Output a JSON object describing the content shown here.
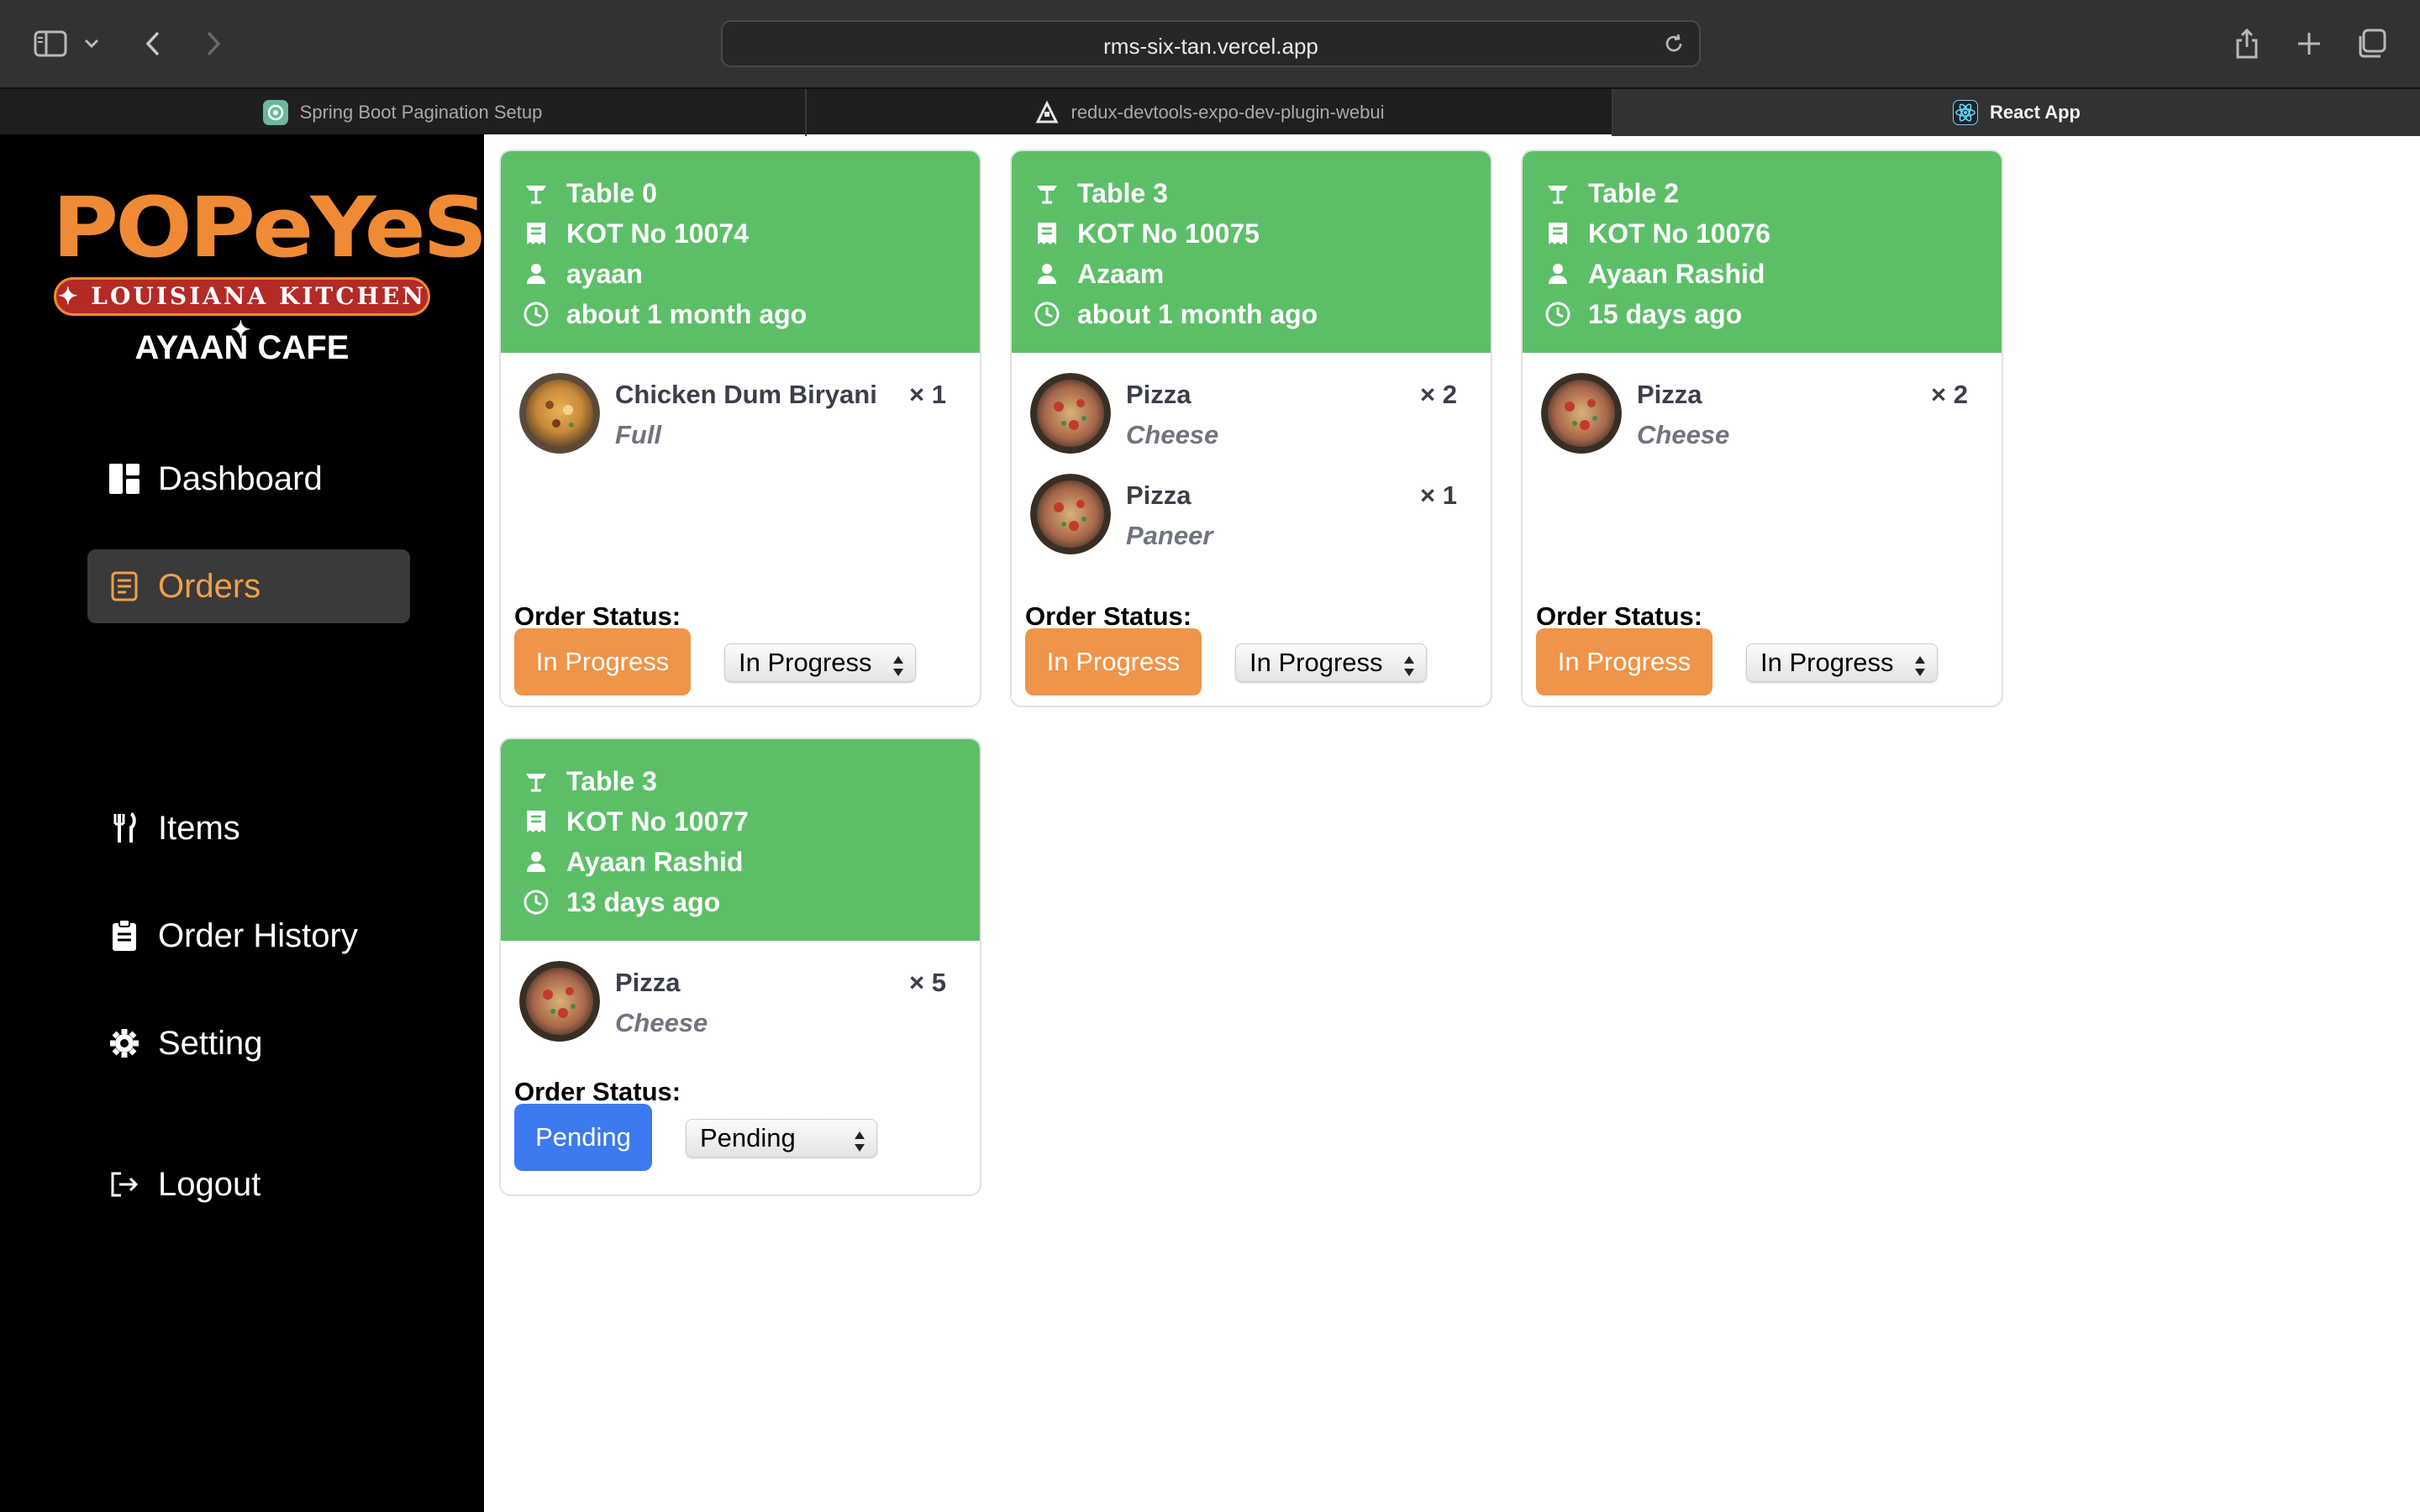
{
  "browser": {
    "url": "rms-six-tan.vercel.app",
    "tabs": [
      {
        "label": "Spring Boot Pagination Setup",
        "icon": "chatgpt-icon",
        "active": false
      },
      {
        "label": "redux-devtools-expo-dev-plugin-webui",
        "icon": "expo-icon",
        "active": false
      },
      {
        "label": "React App",
        "icon": "react-icon",
        "active": true
      }
    ]
  },
  "sidebar": {
    "logo_word": "POPeYeS",
    "logo_band": "✦ LOUISIANA KITCHEN ✦",
    "cafe_name": "AYAAN CAFE",
    "nav": [
      {
        "label": "Dashboard",
        "icon": "dashboard-icon"
      },
      {
        "label": "Orders",
        "icon": "orders-icon",
        "active": true
      },
      {
        "label": "Items",
        "icon": "utensils-icon"
      },
      {
        "label": "Order History",
        "icon": "clipboard-icon"
      },
      {
        "label": "Setting",
        "icon": "gear-icon"
      },
      {
        "label": "Logout",
        "icon": "logout-icon"
      }
    ]
  },
  "orders": [
    {
      "table": "Table 0",
      "kot": "KOT No 10074",
      "customer": "ayaan",
      "time": "about 1 month ago",
      "items": [
        {
          "name": "Chicken Dum Biryani",
          "variant": "Full",
          "qty": "× 1",
          "image": "biryani"
        }
      ],
      "status_label": "Order Status:",
      "status": "In Progress",
      "status_color": "#ef9448",
      "select_value": "In Progress"
    },
    {
      "table": "Table 3",
      "kot": "KOT No 10075",
      "customer": "Azaam",
      "time": "about 1 month ago",
      "items": [
        {
          "name": "Pizza",
          "variant": "Cheese",
          "qty": "× 2",
          "image": "pizza"
        },
        {
          "name": "Pizza",
          "variant": "Paneer",
          "qty": "× 1",
          "image": "pizza"
        }
      ],
      "status_label": "Order Status:",
      "status": "In Progress",
      "status_color": "#ef9448",
      "select_value": "In Progress"
    },
    {
      "table": "Table 2",
      "kot": "KOT No 10076",
      "customer": "Ayaan Rashid",
      "time": "15 days ago",
      "items": [
        {
          "name": "Pizza",
          "variant": "Cheese",
          "qty": "× 2",
          "image": "pizza"
        }
      ],
      "status_label": "Order Status:",
      "status": "In Progress",
      "status_color": "#ef9448",
      "select_value": "In Progress"
    },
    {
      "table": "Table 3",
      "kot": "KOT No 10077",
      "customer": "Ayaan Rashid",
      "time": "13 days ago",
      "items": [
        {
          "name": "Pizza",
          "variant": "Cheese",
          "qty": "× 5",
          "image": "pizza"
        }
      ],
      "status_label": "Order Status:",
      "status": "Pending",
      "status_color": "#3d7af0",
      "select_value": "Pending"
    }
  ]
}
